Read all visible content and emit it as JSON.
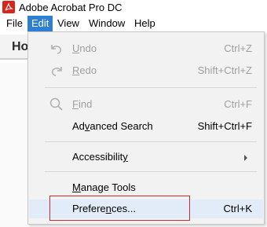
{
  "app": {
    "title": "Adobe Acrobat Pro DC",
    "icon": "acrobat-logo-icon",
    "brand_color": "#d7261b"
  },
  "menubar": {
    "items": [
      {
        "label": "File"
      },
      {
        "label": "Edit",
        "active": true
      },
      {
        "label": "View"
      },
      {
        "label": "Window"
      },
      {
        "label": "Help"
      }
    ],
    "active_color": "#2d7fd4"
  },
  "background": {
    "tab_label": "Ho"
  },
  "edit_menu": {
    "items": [
      {
        "id": "undo",
        "label": "Undo",
        "mnemonic": "U",
        "shortcut": "Ctrl+Z",
        "enabled": false,
        "icon": "undo-icon"
      },
      {
        "id": "redo",
        "label": "Redo",
        "mnemonic": "R",
        "shortcut": "Shift+Ctrl+Z",
        "enabled": false,
        "icon": "redo-icon"
      },
      {
        "id": "find",
        "label": "Find",
        "mnemonic": "F",
        "shortcut": "Ctrl+F",
        "enabled": false,
        "icon": "search-icon"
      },
      {
        "id": "advanced_search",
        "label": "Advanced Search",
        "mnemonic": "v",
        "shortcut": "Shift+Ctrl+F",
        "enabled": true
      },
      {
        "id": "accessibility",
        "label": "Accessibility",
        "mnemonic": "y",
        "shortcut": "",
        "enabled": true,
        "submenu": true
      },
      {
        "id": "manage_tools",
        "label": "Manage Tools",
        "mnemonic": "M",
        "shortcut": "",
        "enabled": true
      },
      {
        "id": "preferences",
        "label": "Preferences...",
        "mnemonic": "n",
        "shortcut": "Ctrl+K",
        "enabled": true,
        "highlighted": true
      }
    ],
    "highlight_color": "#e2ecf8",
    "focus_outline_color": "#c92a2a"
  }
}
